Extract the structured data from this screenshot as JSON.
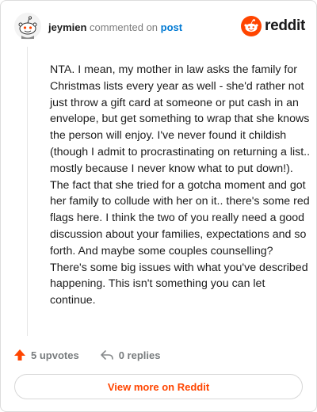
{
  "header": {
    "username": "jeymien",
    "commented_on": "commented on",
    "post_link": "post",
    "logo_text": "reddit"
  },
  "comment": {
    "text": "NTA. I mean, my mother in law asks the family for Christmas lists every year as well - she'd rather not just throw a gift card at someone or put cash in an envelope, but get something to wrap that she knows the person will enjoy. I've never found it childish (though I admit to procrastinating on returning a list.. mostly because I never know what to put down!). The fact that she tried for a gotcha moment and got her family to collude with her on it.. there's some red flags here. I think the two of you really need a good discussion about your families, expectations and so forth. And maybe some couples counselling? There's some big issues with what you've described happening. This isn't something you can let continue."
  },
  "actions": {
    "upvotes": "5 upvotes",
    "replies": "0 replies"
  },
  "footer": {
    "view_more": "View more on Reddit"
  },
  "colors": {
    "accent": "#ff4500",
    "link": "#0079d3",
    "text": "#1c1c1c",
    "muted": "#787c7e"
  },
  "icons": {
    "avatar": "snoo-avatar-icon",
    "logo": "reddit-snoo-icon",
    "upvote": "upvote-arrow-icon",
    "reply": "reply-arrow-icon"
  }
}
